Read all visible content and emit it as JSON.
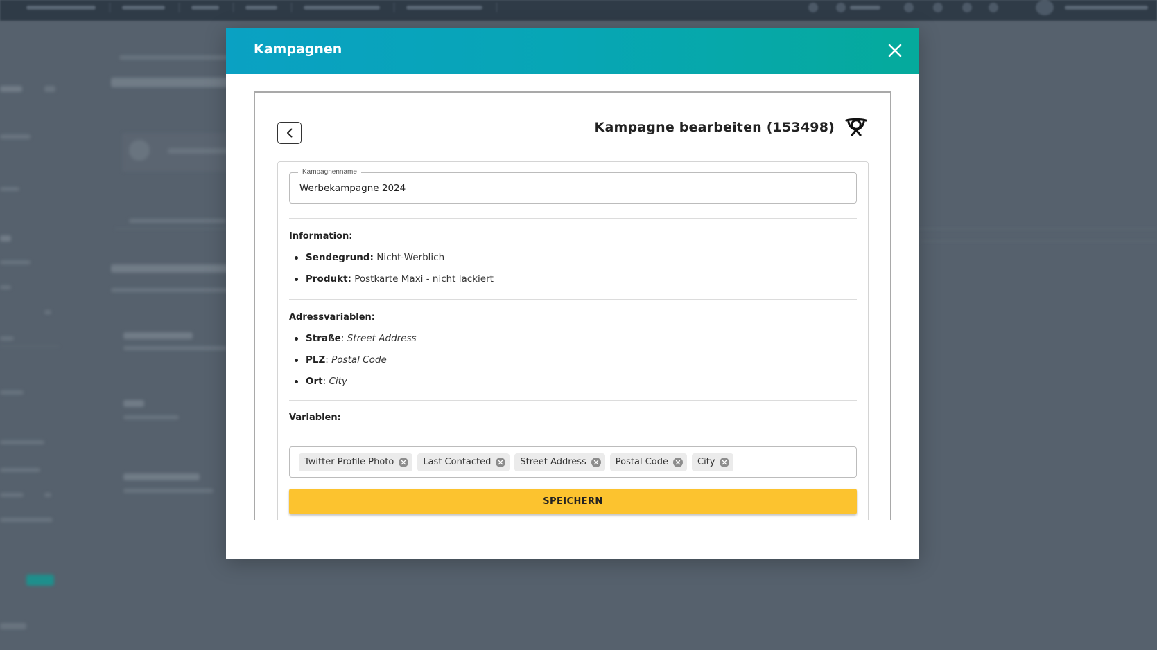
{
  "modal": {
    "title": "Kampagnen"
  },
  "editor": {
    "title": "Kampagne bearbeiten (153498)"
  },
  "campaign_name": {
    "label": "Kampagnenname",
    "value": "Werbekampagne 2024"
  },
  "information": {
    "heading": "Information:",
    "items": [
      {
        "key": "Sendegrund:",
        "value": "Nicht-Werblich"
      },
      {
        "key": "Produkt:",
        "value": "Postkarte Maxi - nicht lackiert"
      }
    ]
  },
  "address_variables": {
    "heading": "Adressvariablen:",
    "items": [
      {
        "key": "Straße",
        "sep": ": ",
        "value": "Street Address"
      },
      {
        "key": "PLZ",
        "sep": ": ",
        "value": "Postal Code"
      },
      {
        "key": "Ort",
        "sep": ": ",
        "value": "City"
      }
    ]
  },
  "variables": {
    "heading": "Variablen:",
    "chips": [
      "Twitter Profile Photo",
      "Last Contacted",
      "Street Address",
      "Postal Code",
      "City"
    ]
  },
  "save_button": {
    "label": "SPEICHERN"
  },
  "colors": {
    "header_gradient_start": "#0aa1c3",
    "header_gradient_end": "#05aa9c",
    "save_button": "#fcc32f",
    "backdrop": "#56616d"
  },
  "icons": {
    "close": "close-icon",
    "back": "chevron-left-icon",
    "logo": "post-horn-logo-icon",
    "chip_remove": "remove-circle-icon"
  }
}
